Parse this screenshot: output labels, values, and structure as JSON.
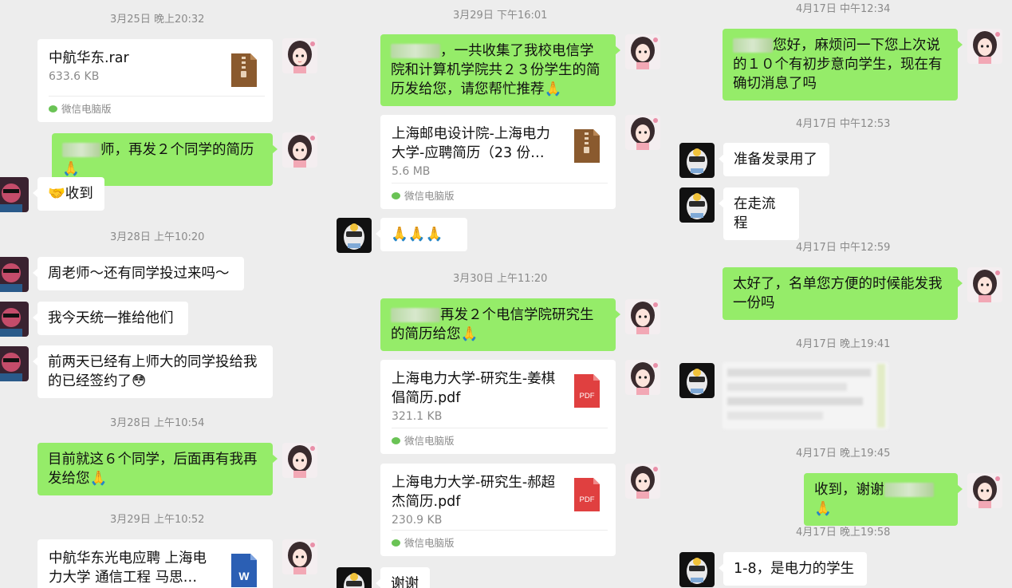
{
  "colors": {
    "background": "#ededed",
    "sent_bubble": "#95ec69",
    "received_bubble": "#ffffff",
    "timestamp": "#8a8a8a"
  },
  "col1": {
    "ts1": "3月25日 晚上20:32",
    "file1": {
      "name": "中航华东.rar",
      "size": "633.6 KB",
      "source": "微信电脑版",
      "icon": "zip-icon"
    },
    "msg1": "师，再发２个同学的简历🙏",
    "msg2": "🤝收到",
    "ts2": "3月28日 上午10:20",
    "msg3": "周老师～还有同学投过来吗～",
    "msg4": "我今天统一推给他们",
    "msg5": "前两天已经有上师大的同学投给我的已经签约了😳",
    "ts3": "3月28日 上午10:54",
    "msg6": "目前就这６个同学，后面再有我再发给您🙏",
    "ts4": "3月29日 上午10:52",
    "file2": {
      "name": "中航华东光电应聘 上海电力大学 通信工程 马思…",
      "icon": "word-icon"
    }
  },
  "col2": {
    "ts1": "3月29日 下午16:01",
    "msg1": "，一共收集了我校电信学院和计算机学院共２３份学生的简历发给您，请您帮忙推荐🙏",
    "file1": {
      "name": "上海邮电设计院-上海电力大学-应聘简历（23 份…",
      "size": "5.6 MB",
      "source": "微信电脑版",
      "icon": "zip-icon"
    },
    "msg2": "🙏🙏🙏",
    "ts2": "3月30日 上午11:20",
    "msg3": "再发２个电信学院研究生的简历给您🙏",
    "file2": {
      "name": "上海电力大学-研究生-姜棋倡简历.pdf",
      "size": "321.1 KB",
      "source": "微信电脑版",
      "icon": "pdf-icon",
      "badge": "PDF"
    },
    "file3": {
      "name": "上海电力大学-研究生-郝超杰简历.pdf",
      "size": "230.9 KB",
      "source": "微信电脑版",
      "icon": "pdf-icon",
      "badge": "PDF"
    },
    "msg4": "谢谢"
  },
  "col3": {
    "ts1": "4月17日 中午12:34",
    "msg1": "您好，麻烦问一下您上次说的１０个有初步意向学生，现在有确切消息了吗",
    "ts2": "4月17日 中午12:53",
    "msg2": "准备发录用了",
    "msg3": "在走流程",
    "ts3": "4月17日 中午12:59",
    "msg4": "太好了，名单您方便的时候能发我一份吗",
    "ts4": "4月17日 晚上19:41",
    "ts5": "4月17日 晚上19:45",
    "msg5": "收到，谢谢",
    "msg5_emoji": "🙏",
    "ts6": "4月17日 晚上19:58",
    "msg6": "1-8，是电力的学生"
  }
}
